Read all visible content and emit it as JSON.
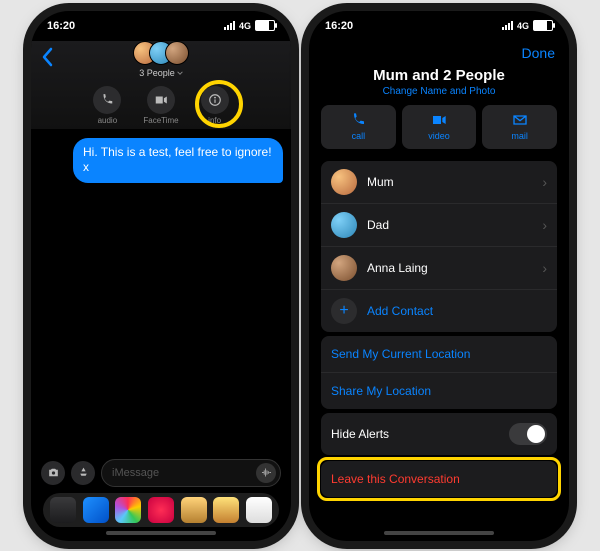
{
  "statusBar": {
    "time": "16:20",
    "network": "4G"
  },
  "left": {
    "groupLabel": "3 People",
    "quick": {
      "audio": "audio",
      "facetime": "FaceTime",
      "info": "info"
    },
    "message": "Hi. This is a test, feel free to ignore! x",
    "inputPlaceholder": "iMessage"
  },
  "right": {
    "done": "Done",
    "title": "Mum and 2 People",
    "changeLink": "Change Name and Photo",
    "tiles": {
      "call": "call",
      "video": "video",
      "mail": "mail"
    },
    "members": [
      {
        "name": "Mum"
      },
      {
        "name": "Dad"
      },
      {
        "name": "Anna Laing"
      }
    ],
    "addContact": "Add Contact",
    "sendLocation": "Send My Current Location",
    "shareLocation": "Share My Location",
    "hideAlerts": "Hide Alerts",
    "leave": "Leave this Conversation"
  }
}
